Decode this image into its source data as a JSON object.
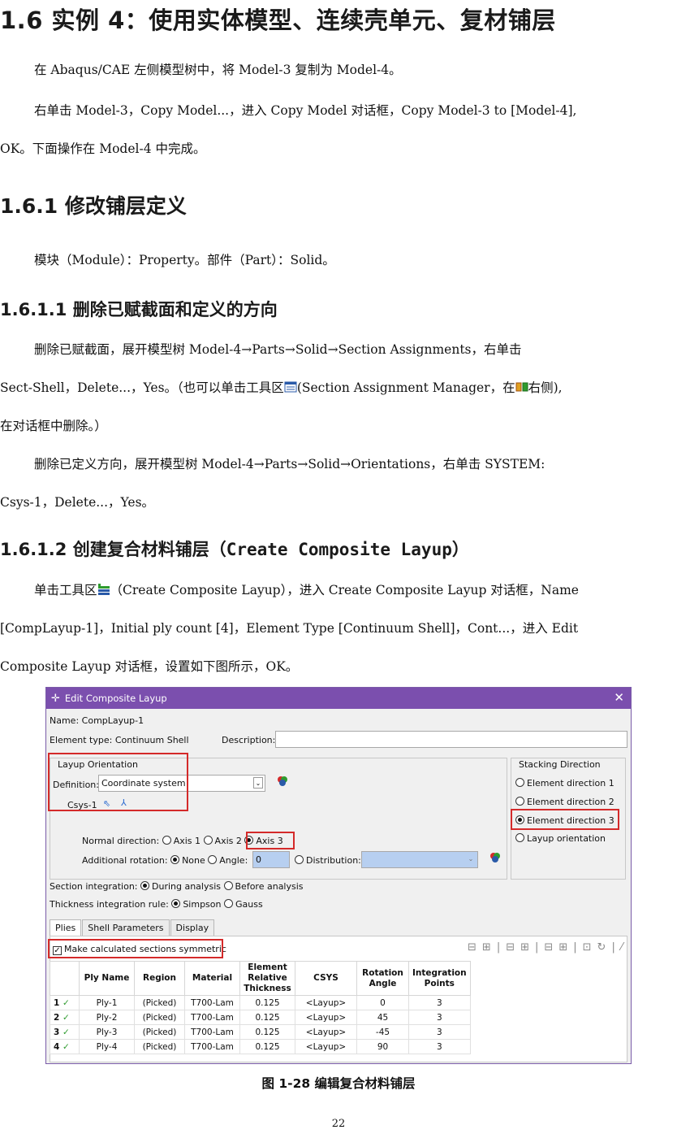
{
  "heading1": "1.6 实例 4：使用实体模型、连续壳单元、复材铺层",
  "para1": "在 Abaqus/CAE 左侧模型树中，将 Model-3 复制为 Model-4。",
  "para2_line1": "右单击 Model-3，Copy Model...，进入 Copy Model 对话框，Copy Model-3 to [Model-4],",
  "para2_line2": "OK。下面操作在 Model-4 中完成。",
  "heading2": "1.6.1 修改铺层定义",
  "para3": "模块（Module）：Property。部件（Part）：Solid。",
  "heading3a": "1.6.1.1 删除已赋截面和定义的方向",
  "para4_line1": "删除已赋截面，展开模型树 Model-4→Parts→Solid→Section Assignments，右单击",
  "para4_line2a": "Sect-Shell，Delete...，Yes。（也可以单击工具区",
  "para4_line2b": "(Section Assignment Manager，在",
  "para4_line2c": "右侧),",
  "para4_line3": "在对话框中删除。）",
  "para5_line1": "删除已定义方向，展开模型树 Model-4→Parts→Solid→Orientations，右单击 SYSTEM:",
  "para5_line2": "Csys-1，Delete...，Yes。",
  "heading3b_prefix": "1.6.1.2 创建复合材料铺层（",
  "heading3b_mono": "Create Composite Layup",
  "heading3b_suffix": "）",
  "para6_line1a": "单击工具区",
  "para6_line1b": "（Create Composite Layup），进入 Create Composite Layup 对话框，Name",
  "para6_line2": "[CompLayup-1]，Initial ply count [4]，Element Type [Continuum Shell]，Cont...，进入 Edit",
  "para6_line3": "Composite Layup 对话框，设置如下图所示，OK。",
  "dialog": {
    "title": "Edit Composite Layup",
    "name_label": "Name:",
    "name_value": "CompLayup-1",
    "etype_label": "Element type:",
    "etype_value": "Continuum Shell",
    "desc_label": "Description:",
    "layup_orientation": "Layup Orientation",
    "definition_label": "Definition:",
    "definition_value": "Coordinate system",
    "csys": "Csys-1",
    "stacking_title": "Stacking Direction",
    "stacking_options": [
      "Element direction 1",
      "Element direction 2",
      "Element direction 3",
      "Layup orientation"
    ],
    "normal_dir_label": "Normal direction:",
    "axis1": "Axis 1",
    "axis2": "Axis 2",
    "axis3": "Axis 3",
    "add_rot_label": "Additional rotation:",
    "none": "None",
    "angle": "Angle:",
    "angle_value": "0",
    "distribution": "Distribution:",
    "section_integration_label": "Section integration:",
    "during": "During analysis",
    "before": "Before analysis",
    "thickness_rule_label": "Thickness integration rule:",
    "simpson": "Simpson",
    "gauss": "Gauss",
    "tabs": [
      "Plies",
      "Shell Parameters",
      "Display"
    ],
    "symmetric": "Make calculated sections symmetric",
    "columns": [
      "Ply Name",
      "Region",
      "Material",
      "Element Relative Thickness",
      "CSYS",
      "Rotation Angle",
      "Integration Points"
    ],
    "rows": [
      {
        "idx": "1",
        "name": "Ply-1",
        "region": "(Picked)",
        "material": "T700-Lam",
        "thickness": "0.125",
        "csys": "<Layup>",
        "angle": "0",
        "points": "3"
      },
      {
        "idx": "2",
        "name": "Ply-2",
        "region": "(Picked)",
        "material": "T700-Lam",
        "thickness": "0.125",
        "csys": "<Layup>",
        "angle": "45",
        "points": "3"
      },
      {
        "idx": "3",
        "name": "Ply-3",
        "region": "(Picked)",
        "material": "T700-Lam",
        "thickness": "0.125",
        "csys": "<Layup>",
        "angle": "-45",
        "points": "3"
      },
      {
        "idx": "4",
        "name": "Ply-4",
        "region": "(Picked)",
        "material": "T700-Lam",
        "thickness": "0.125",
        "csys": "<Layup>",
        "angle": "90",
        "points": "3"
      }
    ]
  },
  "caption": "图 1-28  编辑复合材料铺层",
  "page_number": "22",
  "colors": {
    "titlebar": "#7b4fae",
    "highlight": "#d42a2a",
    "check": "#2e9b2e"
  }
}
